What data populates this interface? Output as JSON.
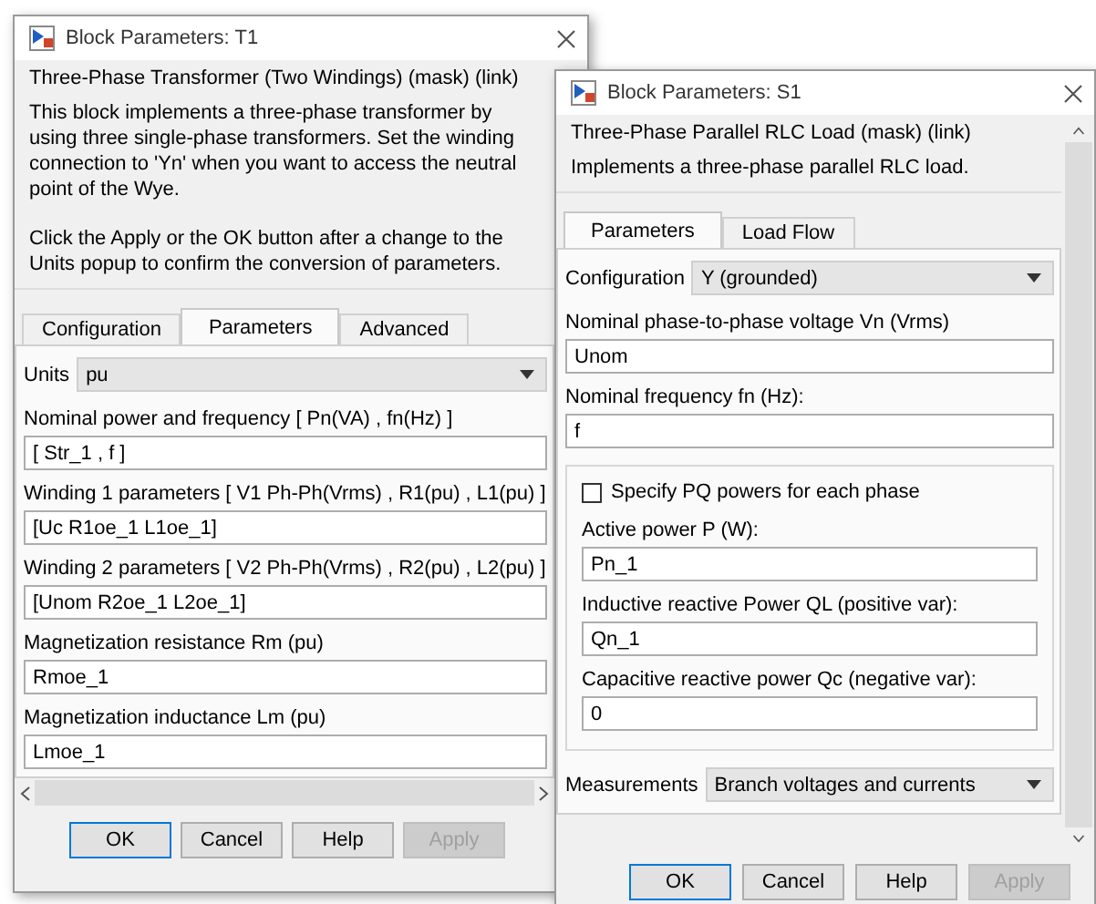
{
  "dialogs": [
    {
      "title": "Block Parameters: T1",
      "header": "Three-Phase Transformer (Two Windings) (mask) (link)",
      "description": [
        "This block implements a three-phase transformer by using three single-phase transformers. Set the winding connection to 'Yn'  when you want to access the neutral point of the Wye.",
        "Click the Apply or the OK button after a change to the Units popup to confirm the conversion of parameters."
      ],
      "tabs": [
        {
          "label": "Configuration",
          "selected": false
        },
        {
          "label": "Parameters",
          "selected": true
        },
        {
          "label": "Advanced",
          "selected": false
        }
      ],
      "params": [
        {
          "kind": "dropdown",
          "label": "Units",
          "value": "pu"
        },
        {
          "kind": "field",
          "label": "Nominal power and frequency  [ Pn(VA) , fn(Hz) ]",
          "value": "[ Str_1 , f ]"
        },
        {
          "kind": "field",
          "label": "Winding 1 parameters [ V1 Ph-Ph(Vrms) , R1(pu) , L1(pu) ]",
          "value": "[Uc R1oe_1 L1oe_1]"
        },
        {
          "kind": "field",
          "label": "Winding 2 parameters [ V2 Ph-Ph(Vrms) , R2(pu) , L2(pu) ]",
          "value": "[Unom R2oe_1 L2oe_1]"
        },
        {
          "kind": "field",
          "label": "Magnetization resistance  Rm (pu)",
          "value": "Rmoe_1"
        },
        {
          "kind": "field",
          "label": "Magnetization inductance  Lm (pu)",
          "value": "Lmoe_1"
        }
      ],
      "buttons": [
        {
          "label": "OK",
          "disabled": false
        },
        {
          "label": "Cancel",
          "disabled": false
        },
        {
          "label": "Help",
          "disabled": false
        },
        {
          "label": "Apply",
          "disabled": true
        }
      ]
    },
    {
      "title": "Block Parameters: S1",
      "header": "Three-Phase Parallel RLC Load (mask) (link)",
      "description": [
        "Implements a three-phase parallel RLC load."
      ],
      "tabs": [
        {
          "label": "Parameters",
          "selected": true
        },
        {
          "label": "Load Flow",
          "selected": false
        }
      ],
      "params": [
        {
          "kind": "dropdown",
          "label": "Configuration",
          "value": "Y (grounded)"
        },
        {
          "kind": "field",
          "label": "Nominal phase-to-phase voltage Vn (Vrms)",
          "value": "Unom"
        },
        {
          "kind": "field",
          "label": "Nominal frequency fn (Hz):",
          "value": "f"
        },
        {
          "kind": "group",
          "children": [
            {
              "kind": "checkbox",
              "label": "Specify PQ powers for each phase",
              "checked": false
            },
            {
              "kind": "field",
              "label": "Active power P (W):",
              "value": "Pn_1"
            },
            {
              "kind": "field",
              "label": "Inductive reactive Power QL (positive var):",
              "value": "Qn_1"
            },
            {
              "kind": "field",
              "label": "Capacitive reactive power Qc (negative var):",
              "value": "0"
            }
          ]
        },
        {
          "kind": "dropdown",
          "label": "Measurements",
          "value": "Branch voltages and currents"
        }
      ],
      "buttons": [
        {
          "label": "OK",
          "disabled": false
        },
        {
          "label": "Cancel",
          "disabled": false
        },
        {
          "label": "Help",
          "disabled": false
        },
        {
          "label": "Apply",
          "disabled": true
        }
      ]
    }
  ]
}
